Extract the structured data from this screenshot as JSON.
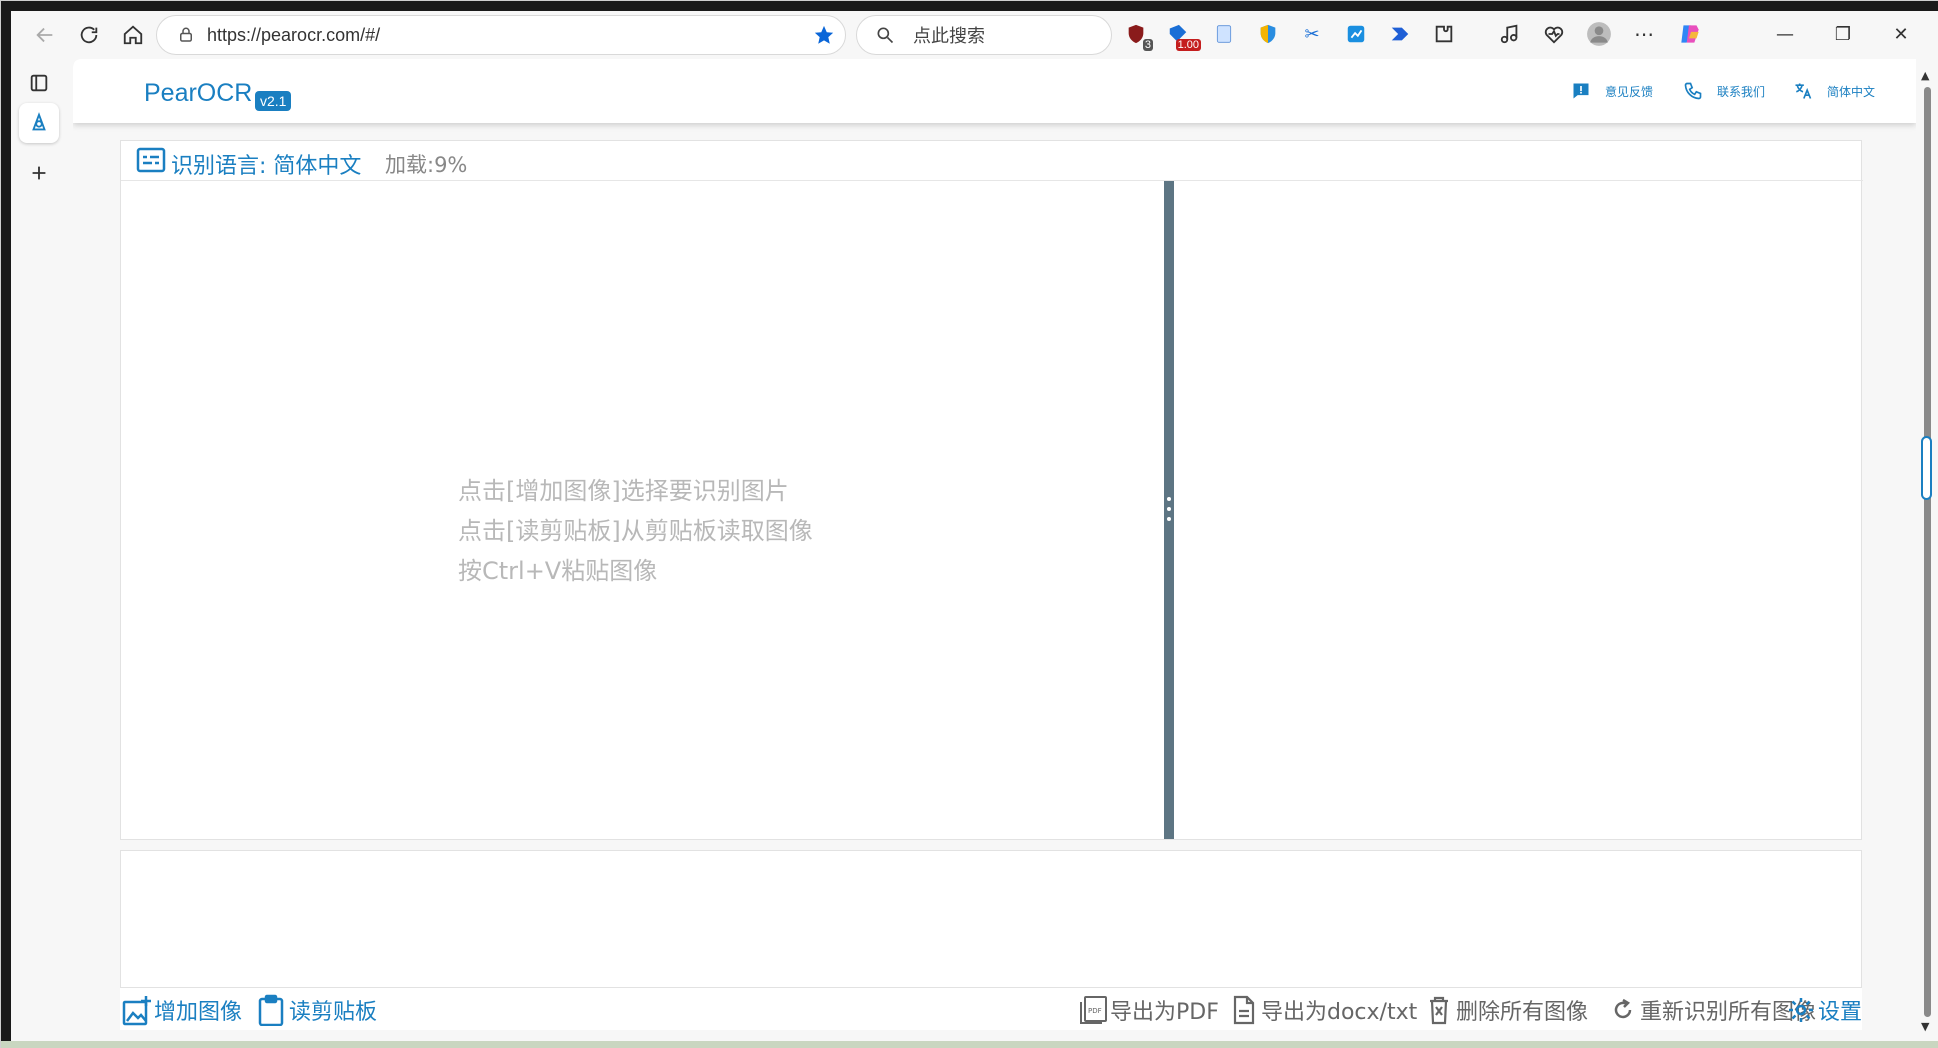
{
  "browser": {
    "url": "https://pearocr.com/#/",
    "search_placeholder": "点此搜索",
    "ext_badges": {
      "shield_count": "3",
      "price": "1.00"
    }
  },
  "app": {
    "logo": "PearOCR",
    "version": "v2.1",
    "header_links": {
      "feedback": "意见反馈",
      "contact": "联系我们",
      "language": "简体中文"
    },
    "language_label": "识别语言: 简体中文",
    "loading_label": "加载:9%",
    "hint_lines": [
      "点击[增加图像]选择要识别图片",
      "点击[读剪贴板]从剪贴板读取图像",
      "按Ctrl+V粘贴图像"
    ],
    "actions": {
      "add_image": "增加图像",
      "read_clipboard": "读剪贴板",
      "export_pdf": "导出为PDF",
      "export_docx": "导出为docx/txt",
      "delete_all": "删除所有图像",
      "re_recognize": "重新识别所有图像",
      "settings": "设置"
    }
  },
  "colors": {
    "accent": "#1a7fc1",
    "splitter": "#5d7583",
    "hint_text": "#b8b8b8"
  }
}
